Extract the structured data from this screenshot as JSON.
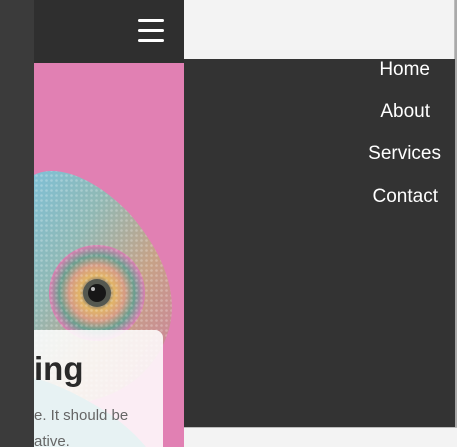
{
  "header": {
    "menu_icon": "hamburger-menu-icon"
  },
  "hero": {
    "title": "ing",
    "text_line_1": "e. It should be",
    "text_line_2": "ative."
  },
  "nav": {
    "items": [
      {
        "label": "Home"
      },
      {
        "label": "About"
      },
      {
        "label": "Services"
      },
      {
        "label": "Contact"
      }
    ]
  },
  "colors": {
    "header_bg": "#2f2f2f",
    "nav_bg": "#333333",
    "hero_pink": "#df76ad",
    "text_dark": "#2a2a2a",
    "text_muted": "#666666"
  }
}
